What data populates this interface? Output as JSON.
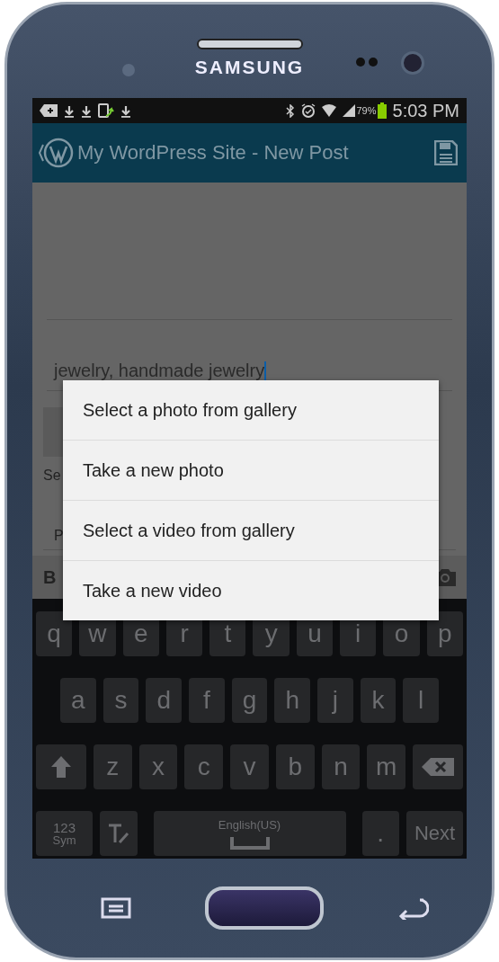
{
  "device": {
    "brand": "SAMSUNG"
  },
  "status_bar": {
    "battery": "79%",
    "time": "5:03 PM"
  },
  "app_bar": {
    "title": "My WordPress Site - New Post"
  },
  "editor": {
    "tags": "jewelry, handmade jewelry",
    "label_fragment": "Se",
    "field_fragment": "P",
    "toolbar_fragment": "B"
  },
  "dialog": {
    "items": [
      "Select a photo from gallery",
      "Take a new photo",
      "Select a video from gallery",
      "Take a new video"
    ]
  },
  "keyboard": {
    "rows": [
      [
        {
          "kind": "letter",
          "label": "q"
        },
        {
          "kind": "letter",
          "label": "w"
        },
        {
          "kind": "letter",
          "label": "e"
        },
        {
          "kind": "letter",
          "label": "r"
        },
        {
          "kind": "letter",
          "label": "t"
        },
        {
          "kind": "letter",
          "label": "y"
        },
        {
          "kind": "letter",
          "label": "u"
        },
        {
          "kind": "letter",
          "label": "i"
        },
        {
          "kind": "letter",
          "label": "o"
        },
        {
          "kind": "letter",
          "label": "p"
        }
      ],
      [
        {
          "kind": "letter",
          "label": "a"
        },
        {
          "kind": "letter",
          "label": "s"
        },
        {
          "kind": "letter",
          "label": "d"
        },
        {
          "kind": "letter",
          "label": "f"
        },
        {
          "kind": "letter",
          "label": "g"
        },
        {
          "kind": "letter",
          "label": "h"
        },
        {
          "kind": "letter",
          "label": "j"
        },
        {
          "kind": "letter",
          "label": "k"
        },
        {
          "kind": "letter",
          "label": "l"
        }
      ],
      [
        {
          "kind": "shift"
        },
        {
          "kind": "letter",
          "label": "z"
        },
        {
          "kind": "letter",
          "label": "x"
        },
        {
          "kind": "letter",
          "label": "c"
        },
        {
          "kind": "letter",
          "label": "v"
        },
        {
          "kind": "letter",
          "label": "b"
        },
        {
          "kind": "letter",
          "label": "n"
        },
        {
          "kind": "letter",
          "label": "m"
        },
        {
          "kind": "backspace"
        }
      ]
    ],
    "bottom_row": [
      {
        "kind": "symbols",
        "label": "123",
        "sub": "Sym"
      },
      {
        "kind": "text-tool"
      },
      {
        "kind": "space",
        "label": "English(US)"
      },
      {
        "kind": "period",
        "label": "."
      },
      {
        "kind": "action",
        "label": "Next"
      }
    ]
  }
}
